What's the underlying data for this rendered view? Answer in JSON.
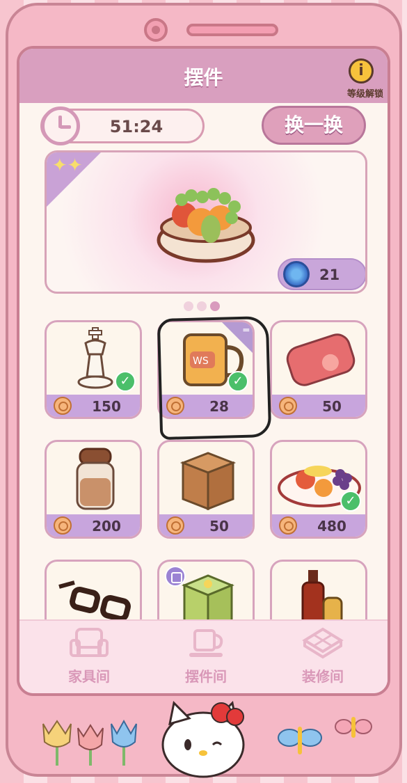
{
  "header": {
    "title": "摆件",
    "info_label": "等级解锁",
    "info_symbol": "i"
  },
  "timer": {
    "value": "51:24"
  },
  "swap_button": {
    "label": "换一换"
  },
  "featured": {
    "item_icon": "fruit-bowl-icon",
    "gem_count": "21",
    "page_dots": 3,
    "active_dot": 3
  },
  "items": [
    {
      "icon": "chess-king-icon",
      "price": "150",
      "owned": true
    },
    {
      "icon": "mug-icon",
      "price": "28",
      "owned": true,
      "tag": "corner"
    },
    {
      "icon": "pillow-icon",
      "price": "50",
      "owned": false
    },
    {
      "icon": "spice-jar-icon",
      "price": "200",
      "owned": false
    },
    {
      "icon": "cardboard-box-icon",
      "price": "50",
      "owned": false
    },
    {
      "icon": "fruit-plate-icon",
      "price": "480",
      "owned": true
    },
    {
      "icon": "glasses-icon",
      "price": "",
      "owned": true
    },
    {
      "icon": "drawer-cube-icon",
      "price": "",
      "owned": false,
      "tag": "bubble"
    },
    {
      "icon": "condiment-bottles-icon",
      "price": "",
      "owned": true
    }
  ],
  "bottom_nav": [
    {
      "label": "家具间",
      "icon": "armchair-icon"
    },
    {
      "label": "摆件间",
      "icon": "cup-icon"
    },
    {
      "label": "装修间",
      "icon": "floor-tile-icon"
    }
  ],
  "colors": {
    "accent": "#d99fbf",
    "price_bar": "#c8a5dd",
    "owned_check": "#4bbf6a"
  }
}
